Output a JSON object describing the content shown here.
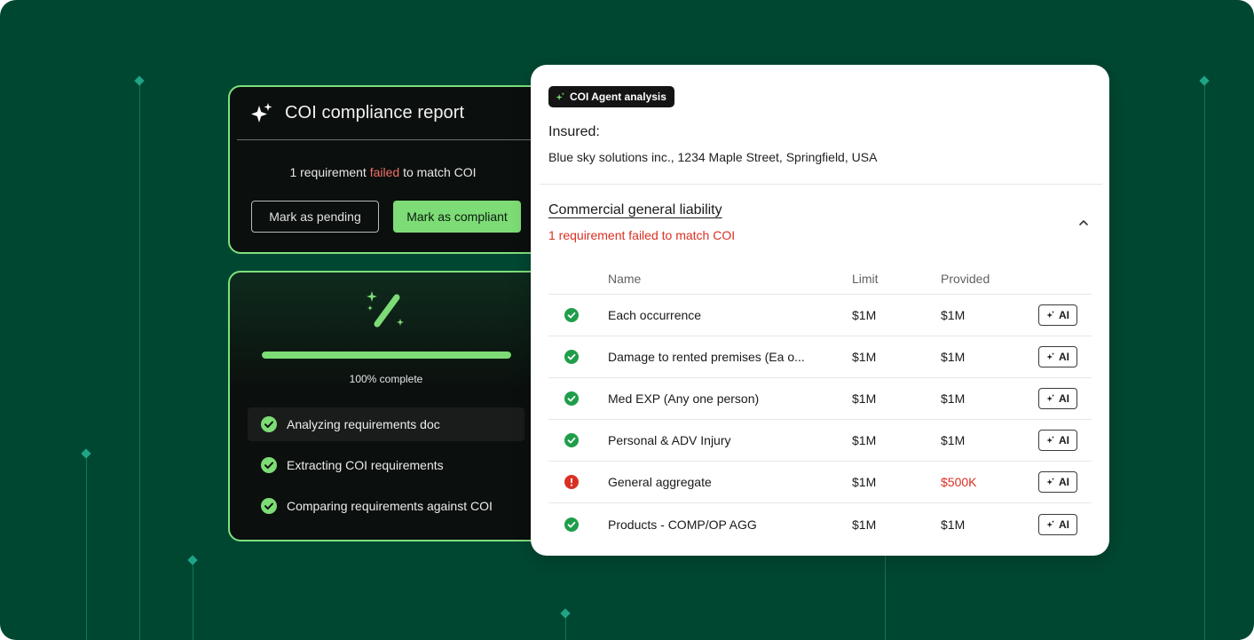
{
  "report": {
    "title": "COI compliance report",
    "msg_prefix": "1 requirement ",
    "msg_failed": "failed",
    "msg_suffix": " to match COI",
    "pending_label": "Mark as pending",
    "compliant_label": "Mark as compliant"
  },
  "progress": {
    "percent": 100,
    "label": "100% complete",
    "steps": [
      {
        "label": "Analyzing requirements doc",
        "status": "done"
      },
      {
        "label": "Extracting COI requirements",
        "status": "done"
      },
      {
        "label": "Comparing requirements against COI",
        "status": "done"
      }
    ]
  },
  "panel": {
    "badge": "COI Agent analysis",
    "insured_label": "Insured:",
    "insured_value": "Blue sky solutions inc., 1234 Maple Street, Springfield, USA",
    "section_title": "Commercial general liability",
    "section_subtitle": "1 requirement failed to match COI",
    "columns": {
      "name": "Name",
      "limit": "Limit",
      "provided": "Provided"
    },
    "ai_label": "AI",
    "rows": [
      {
        "name": "Each occurrence",
        "limit": "$1M",
        "provided": "$1M",
        "status": "pass"
      },
      {
        "name": "Damage to rented premises (Ea o...",
        "limit": "$1M",
        "provided": "$1M",
        "status": "pass"
      },
      {
        "name": "Med EXP (Any one person)",
        "limit": "$1M",
        "provided": "$1M",
        "status": "pass"
      },
      {
        "name": "Personal & ADV Injury",
        "limit": "$1M",
        "provided": "$1M",
        "status": "pass"
      },
      {
        "name": "General aggregate",
        "limit": "$1M",
        "provided": "$500K",
        "status": "fail"
      },
      {
        "name": "Products - COMP/OP AGG",
        "limit": "$1M",
        "provided": "$1M",
        "status": "pass"
      }
    ]
  },
  "colors": {
    "background": "#004731",
    "accent_green": "#7ddc75",
    "fail_red": "#d93025",
    "pass_green": "#1e9e4a"
  },
  "icons": {
    "report": "sparkle-icon",
    "progress": "magic-wand-icon",
    "step": "check-circle-icon",
    "collapse": "chevron-up-icon",
    "pass": "check-circle-icon",
    "fail": "alert-circle-icon"
  }
}
